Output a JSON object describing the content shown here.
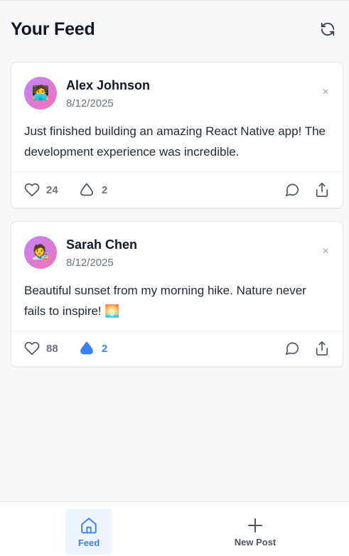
{
  "header": {
    "title": "Your Feed",
    "refresh_icon": "refresh-icon"
  },
  "posts": [
    {
      "avatar_emoji": "🧑‍💻",
      "author": "Alex Johnson",
      "date": "8/12/2025",
      "dismiss": "×",
      "content": "Just finished building an amazing React Native app! The development experience was incredible.",
      "likes": "24",
      "drops": "2",
      "drop_active": false
    },
    {
      "avatar_emoji": "🧑‍🎨",
      "author": "Sarah Chen",
      "date": "8/12/2025",
      "dismiss": "×",
      "content": "Beautiful sunset from my morning hike. Nature never fails to inspire! 🌅",
      "likes": "88",
      "drops": "2",
      "drop_active": true
    }
  ],
  "tabbar": {
    "feed_label": "Feed",
    "new_post_label": "New Post"
  },
  "colors": {
    "accent": "#3b82f6",
    "muted": "#6b7280",
    "avatar_gradient_start": "#c084fc",
    "avatar_gradient_end": "#f472b6",
    "background": "#f7f8fa"
  }
}
